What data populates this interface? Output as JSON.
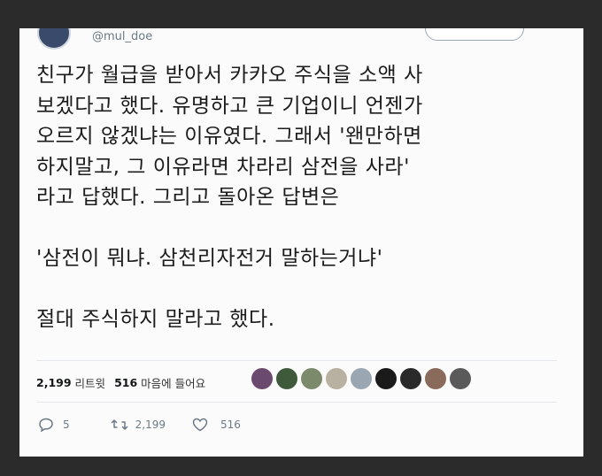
{
  "tweet": {
    "handle": "@mul_doe",
    "text": "친구가 월급을 받아서 카카오 주식을 소액 사\n보겠다고 했다. 유명하고 큰 기업이니 언젠가\n오르지 않겠냐는 이유였다. 그래서 '왠만하면\n하지말고, 그 이유라면 차라리 삼전을 사라'\n라고 답했다. 그리고 돌아온 답변은\n\n'삼전이 뭐냐. 삼천리자전거 말하는거냐'\n\n절대 주식하지 말라고 했다.",
    "retweet_count": "2,199",
    "retweet_label": "리트윗",
    "like_count": "516",
    "like_label": "마음에 들어요",
    "reply_count": "5",
    "retweet_action_count": "2,199",
    "like_action_count": "516"
  },
  "likers": [
    "#6a4a6e",
    "#3e5a3a",
    "#7a8a6a",
    "#b8b0a0",
    "#9aa6b2",
    "#1a1a1a",
    "#2a2a2a",
    "#8a6a5a",
    "#5a5a5a"
  ]
}
